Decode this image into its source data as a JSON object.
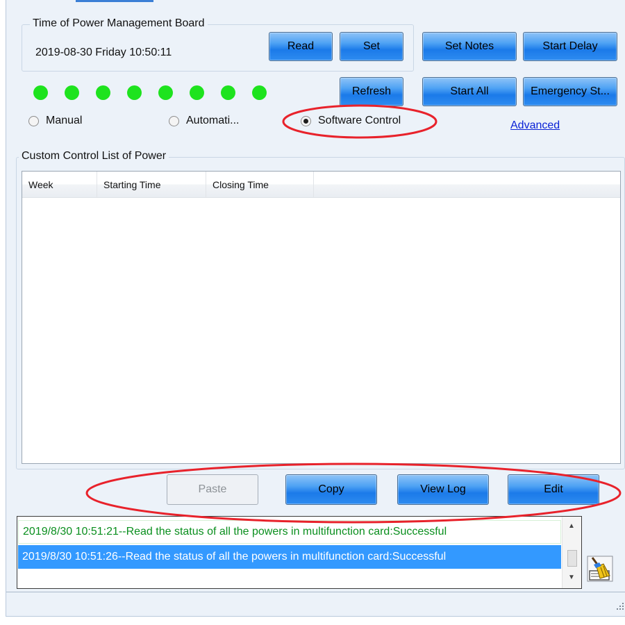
{
  "time_group": {
    "title": "Time of Power Management Board",
    "datetime": "2019-08-30 Friday 10:50:11"
  },
  "buttons": {
    "read": "Read",
    "set": "Set",
    "set_notes": "Set Notes",
    "start_delay": "Start Delay",
    "refresh": "Refresh",
    "start_all": "Start All",
    "emergency_stop": "Emergency St..."
  },
  "power_indicators": [
    "on",
    "on",
    "on",
    "on",
    "on",
    "on",
    "on",
    "on"
  ],
  "indicator_color": "#1ee31e",
  "mode": {
    "manual": "Manual",
    "automatic": "Automati...",
    "software_control": "Software Control",
    "selected": "software_control"
  },
  "advanced_link": "Advanced",
  "custom_list": {
    "title": "Custom Control List of Power",
    "columns": [
      "Week",
      "Starting Time",
      "Closing Time"
    ],
    "rows": []
  },
  "action_buttons": {
    "paste": "Paste",
    "copy": "Copy",
    "view_log": "View Log",
    "edit": "Edit"
  },
  "log": {
    "lines": [
      "2019/8/30 10:51:21--Read the status of all the powers in multifunction card:Successful",
      "2019/8/30 10:51:26--Read the status of all the powers in multifunction card:Successful"
    ],
    "selected_index": 1
  },
  "colors": {
    "button_blue": "#2e8cf0",
    "selection_blue": "#3399ff",
    "highlight_ring": "#e8222b",
    "log_success_text": "#0a8f1e",
    "link_blue": "#0a22d6"
  },
  "icons": {
    "clear_log": "broom-icon",
    "resize_grip": "resize-grip-icon"
  }
}
